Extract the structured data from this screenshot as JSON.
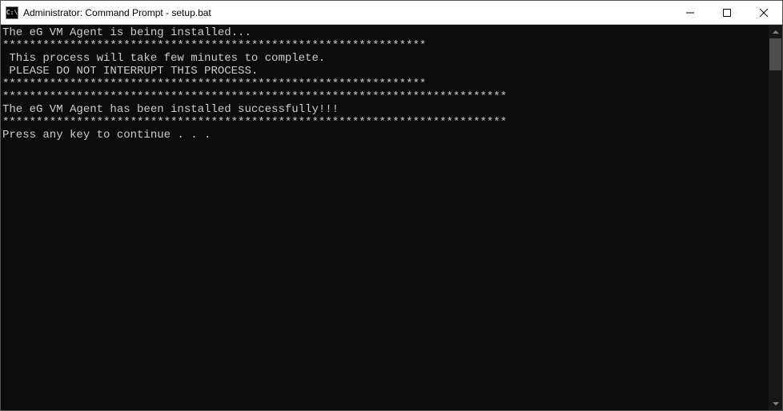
{
  "window": {
    "title": "Administrator: Command Prompt - setup.bat"
  },
  "terminal": {
    "lines": {
      "l0": "",
      "l1": "The eG VM Agent is being installed...",
      "l2": "",
      "l3": "",
      "l4": "***************************************************************",
      "l5": " This process will take few minutes to complete.",
      "l6": " PLEASE DO NOT INTERRUPT THIS PROCESS.",
      "l7": "***************************************************************",
      "l8": "",
      "l9": "***************************************************************************",
      "l10": "The eG VM Agent has been installed successfully!!!",
      "l11": "***************************************************************************",
      "l12": "",
      "l13": "",
      "l14": "Press any key to continue . . ."
    }
  }
}
